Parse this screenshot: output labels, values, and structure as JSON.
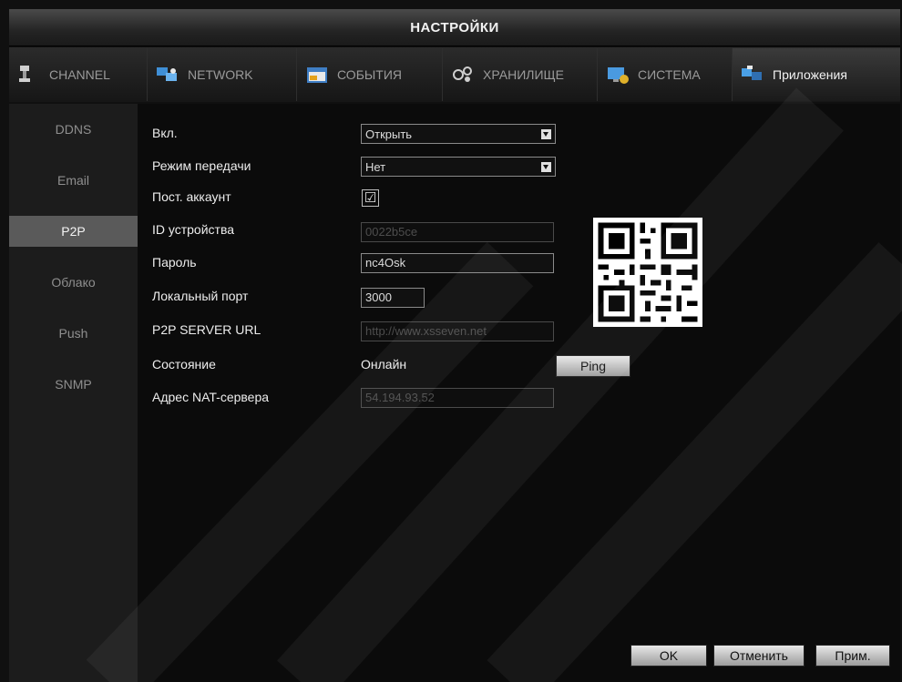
{
  "window": {
    "title": "НАСТРОЙКИ"
  },
  "tabs": [
    {
      "label": "CHANNEL",
      "icon": "camera-icon",
      "active": false
    },
    {
      "label": "NETWORK",
      "icon": "network-icon",
      "active": false
    },
    {
      "label": "СОБЫТИЯ",
      "icon": "calendar-icon",
      "active": false
    },
    {
      "label": "ХРАНИЛИЩЕ",
      "icon": "storage-icon",
      "active": false
    },
    {
      "label": "СИСТЕМА",
      "icon": "system-icon",
      "active": false
    },
    {
      "label": "Приложения",
      "icon": "apps-icon",
      "active": true
    }
  ],
  "sidebar": {
    "items": [
      {
        "label": "DDNS"
      },
      {
        "label": "Email"
      },
      {
        "label": "P2P",
        "active": true
      },
      {
        "label": "Облако"
      },
      {
        "label": "Push"
      },
      {
        "label": "SNMP"
      }
    ]
  },
  "form": {
    "enable": {
      "label": "Вкл.",
      "value": "Открыть"
    },
    "transfer_mode": {
      "label": "Режим передачи",
      "value": "Нет"
    },
    "permanent_account": {
      "label": "Пост. аккаунт",
      "checked": true,
      "mark": "☑"
    },
    "device_id": {
      "label": "ID устройства",
      "value": "0022b5ce"
    },
    "password": {
      "label": "Пароль",
      "value": "nc4Osk"
    },
    "local_port": {
      "label": "Локальный порт",
      "value": "3000"
    },
    "p2p_server_url": {
      "label": "P2P SERVER URL",
      "value": "http://www.xsseven.net"
    },
    "status": {
      "label": "Состояние",
      "value": "Онлайн"
    },
    "nat_server": {
      "label": "Адрес NAT-сервера",
      "value": "54.194.93.52"
    }
  },
  "buttons": {
    "ping": "Ping",
    "ok": "OK",
    "cancel": "Отменить",
    "apply": "Прим."
  },
  "colors": {
    "background": "#101010",
    "sidebar": "#1c1c1c",
    "active_item": "#5a5a5a",
    "text": "#e6e6e6"
  }
}
